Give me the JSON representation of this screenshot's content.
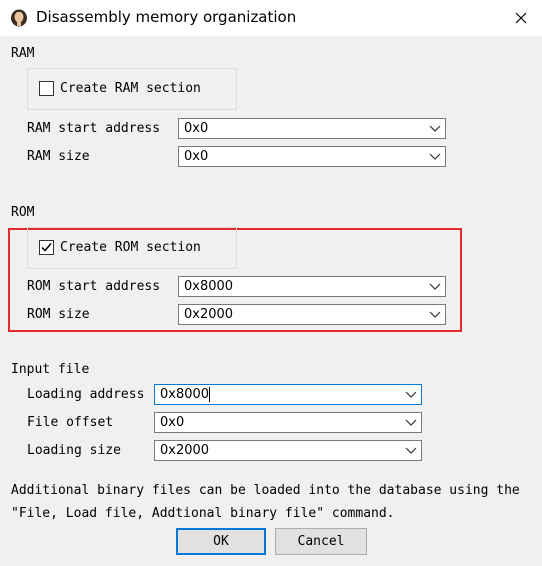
{
  "window": {
    "title": "Disassembly memory organization"
  },
  "ram": {
    "section_label": "RAM",
    "create_label": "Create RAM section",
    "create_checked": false,
    "start_label": "RAM start address",
    "start_value": "0x0",
    "size_label": "RAM size",
    "size_value": "0x0"
  },
  "rom": {
    "section_label": "ROM",
    "create_label": "Create ROM section",
    "create_checked": true,
    "start_label": "ROM start address",
    "start_value": "0x8000",
    "size_label": "ROM size",
    "size_value": "0x2000"
  },
  "input_file": {
    "section_label": "Input file",
    "loading_address_label": "Loading address",
    "loading_address_value": "0x8000",
    "file_offset_label": "File offset",
    "file_offset_value": "0x0",
    "loading_size_label": "Loading size",
    "loading_size_value": "0x2000"
  },
  "info": {
    "line1": "Additional binary files can be loaded into the database using the",
    "line2": "\"File, Load file, Addtional binary file\" command."
  },
  "buttons": {
    "ok": "OK",
    "cancel": "Cancel"
  },
  "colors": {
    "highlight": "#e02b2b",
    "focus": "#0078d7"
  }
}
